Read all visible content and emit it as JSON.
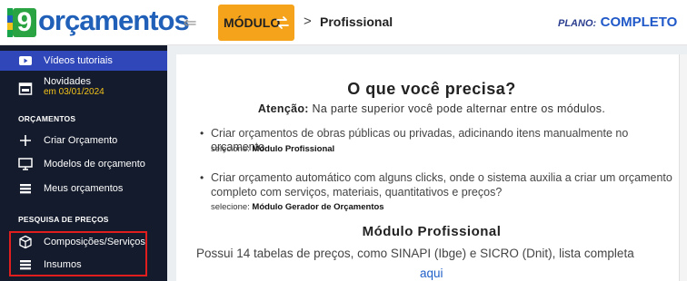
{
  "header": {
    "logo_letter": "9",
    "logo_text": "orçamentos",
    "modulo_label": "MÓDULO",
    "breadcrumb_sep": ">",
    "breadcrumb_current": "Profissional",
    "plan_label": "PLANO:",
    "plan_value": "COMPLETO"
  },
  "sidebar": {
    "videos_label": "Vídeos tutoriais",
    "novidades_label": "Novidades",
    "novidades_date": "em 03/01/2024",
    "section_orcamentos": "ORÇAMENTOS",
    "criar": "Criar Orçamento",
    "modelos": "Modelos de orçamento",
    "meus": "Meus orçamentos",
    "section_pesquisa": "PESQUISA DE PREÇOS",
    "composicoes": "Composições/Serviços",
    "insumos": "Insumos"
  },
  "main": {
    "title": "O que você precisa?",
    "attention_strong": "Atenção:",
    "attention_text": " Na parte superior você pode alternar entre os módulos.",
    "item1_line1": "Criar orçamentos de obras públicas ou privadas, adicinando itens manualmente no orçamento",
    "item1_select_prefix": "selecione: ",
    "item1_select_value": "Módulo Profissional",
    "item2_line1": "Criar orçamento automático com alguns clicks, onde o sistema auxilia a criar um orçamento",
    "item2_line2": "completo com serviços, materiais, quantitativos e preços?",
    "item2_select_prefix": "selecione: ",
    "item2_select_value": "Módulo Gerador de Orçamentos",
    "section_title": "Módulo Profissional",
    "section_desc": "Possui 14 tabelas de preços, como SINAPI (Ibge) e SICRO (Dnit), lista completa",
    "link_text": "aqui"
  },
  "colors": {
    "sidebar_bg": "#141b2c",
    "sidebar_active": "#3047ba",
    "modulo_orange": "#f5a31a",
    "brand_blue": "#2160b8",
    "highlight_red": "#e01e1e",
    "novidades_yellow": "#f2c21b"
  }
}
